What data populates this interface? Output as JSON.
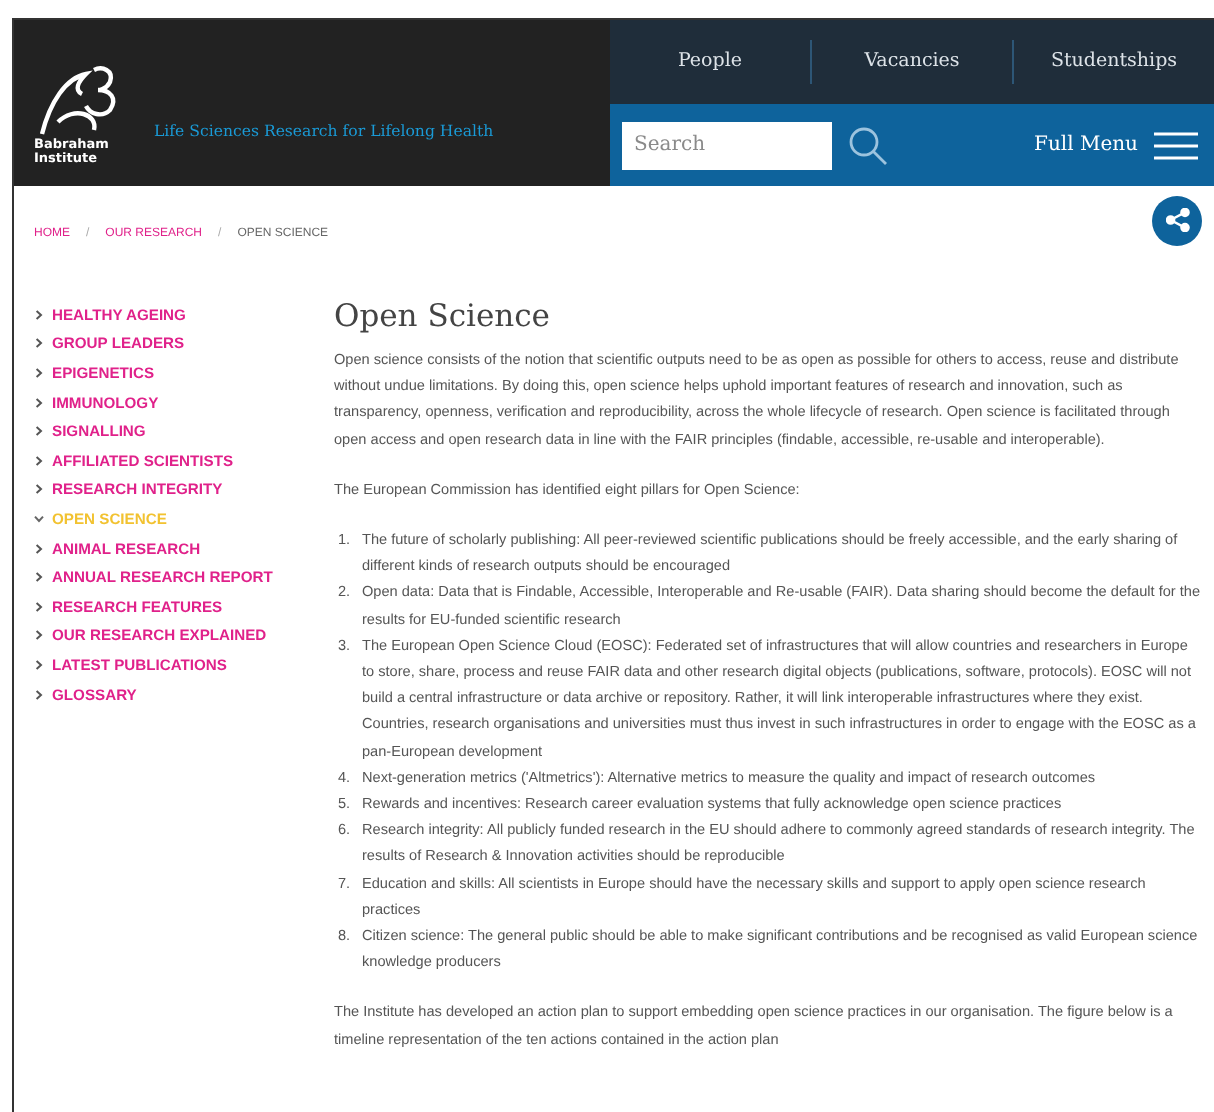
{
  "header": {
    "logo_lines": [
      "Babraham",
      "Institute"
    ],
    "tagline": "Life Sciences Research for Lifelong Health",
    "nav": [
      {
        "label": "People"
      },
      {
        "label": "Vacancies"
      },
      {
        "label": "Studentships"
      }
    ],
    "search": {
      "placeholder": "Search"
    },
    "menu_label": "Full Menu"
  },
  "breadcrumb": [
    {
      "label": "HOME",
      "current": false
    },
    {
      "separator_before": "/",
      "label": "OUR RESEARCH",
      "current": false
    },
    {
      "separator_before": "/",
      "label": "OPEN SCIENCE",
      "current": true
    }
  ],
  "sidebar": {
    "items": [
      {
        "label": "HEALTHY AGEING",
        "selected": false
      },
      {
        "label": "GROUP LEADERS",
        "selected": false
      },
      {
        "label": "EPIGENETICS",
        "selected": false
      },
      {
        "label": "IMMUNOLOGY",
        "selected": false
      },
      {
        "label": "SIGNALLING",
        "selected": false
      },
      {
        "label": "AFFILIATED SCIENTISTS",
        "selected": false
      },
      {
        "label": "RESEARCH INTEGRITY",
        "selected": false
      },
      {
        "label": "OPEN SCIENCE",
        "selected": true
      },
      {
        "label": "ANIMAL RESEARCH",
        "selected": false
      },
      {
        "label": "ANNUAL RESEARCH REPORT",
        "selected": false
      },
      {
        "label": "RESEARCH FEATURES",
        "selected": false
      },
      {
        "label": "OUR RESEARCH EXPLAINED",
        "selected": false
      },
      {
        "label": "LATEST PUBLICATIONS",
        "selected": false
      },
      {
        "label": "GLOSSARY",
        "selected": false
      }
    ]
  },
  "article": {
    "title": "Open Science",
    "intro": [
      "Open science consists of the notion that scientific outputs need to be as open as possible for others to access, reuse and distribute without undue limitations. By doing this, open science helps uphold important features of research and innovation, such as transparency, openness, verification and reproducibility, across the whole lifecycle of research. Open science is facilitated through open access and open research data in line with the FAIR principles (findable, accessible, re-usable and interoperable).",
      "The European Commission has identified eight pillars for Open Science:"
    ],
    "pillars": [
      {
        "number": "1.",
        "text": "The future of scholarly publishing: All peer-reviewed scientific publications should be freely accessible, and the early sharing of different kinds of research outputs should be encouraged"
      },
      {
        "number": "2.",
        "text": "Open data: Data that is Findable, Accessible, Interoperable and Re-usable (FAIR). Data sharing should become the default for the results for EU-funded scientific research"
      },
      {
        "number": "3.",
        "text": "The European Open Science Cloud (EOSC): Federated set of infrastructures that will allow countries and researchers in Europe to store, share, process and reuse FAIR data and other research digital objects (publications, software, protocols). EOSC will not build a central infrastructure or data archive or repository. Rather, it will link interoperable infrastructures where they exist. Countries, research organisations and universities must thus invest in such infrastructures in order to engage with the EOSC as a pan-European development"
      },
      {
        "number": "4.",
        "text": "Next-generation metrics ('Altmetrics'): Alternative metrics to measure the quality and impact of research outcomes"
      },
      {
        "number": "5.",
        "text": "Rewards and incentives: Research career evaluation systems that fully acknowledge open science practices"
      },
      {
        "number": "6.",
        "text": "Research integrity: All publicly funded research in the EU should adhere to commonly agreed standards of research integrity. The results of Research & Innovation activities should be reproducible"
      },
      {
        "number": "7.",
        "text": "Education and skills: All scientists in Europe should have the necessary skills and support to apply open science research practices"
      },
      {
        "number": "8.",
        "text": "Citizen science: The general public should be able to make significant contributions and be recognised as valid European science knowledge producers"
      }
    ],
    "closing": "The Institute has developed an action plan to support embedding open science practices in our organisation. The figure below is a timeline representation of the ten actions contained in the action plan"
  }
}
